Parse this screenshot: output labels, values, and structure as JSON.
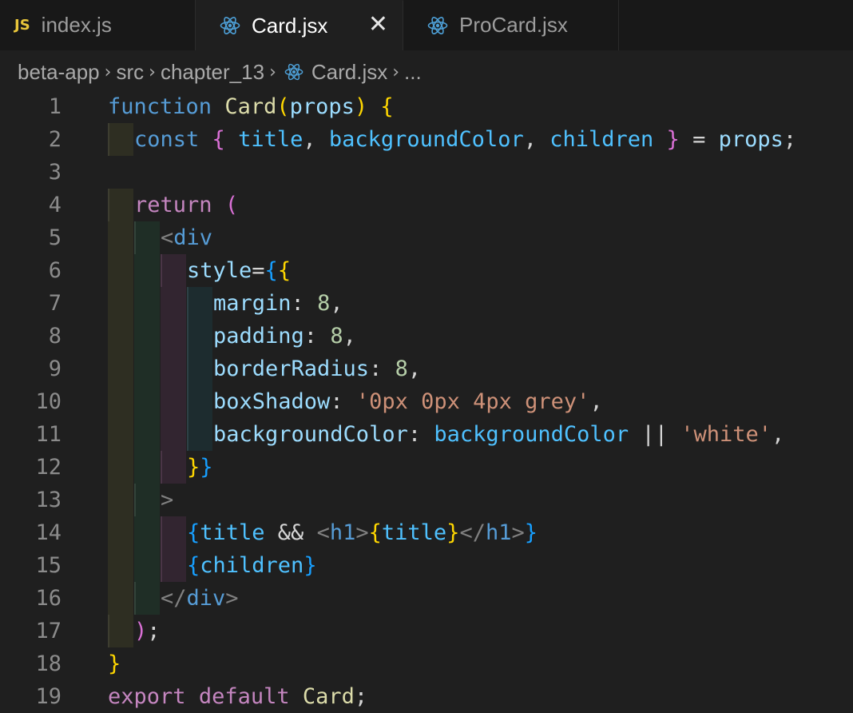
{
  "tabs": [
    {
      "label": "index.js",
      "icon": "js-icon",
      "badge": "JS",
      "active": false
    },
    {
      "label": "Card.jsx",
      "icon": "react-icon",
      "active": true,
      "close": "✕"
    },
    {
      "label": "ProCard.jsx",
      "icon": "react-icon",
      "active": false
    }
  ],
  "breadcrumb": {
    "items": [
      "beta-app",
      "src",
      "chapter_13",
      "Card.jsx"
    ],
    "ellipsis": "..."
  },
  "editor": {
    "line_numbers": [
      "1",
      "2",
      "3",
      "4",
      "5",
      "6",
      "7",
      "8",
      "9",
      "10",
      "11",
      "12",
      "13",
      "14",
      "15",
      "16",
      "17",
      "18",
      "19"
    ],
    "tokens": {
      "function": "function",
      "Card": "Card",
      "props": "props",
      "const": "const",
      "title": "title",
      "backgroundColor": "backgroundColor",
      "children": "children",
      "return": "return",
      "div": "div",
      "style": "style",
      "margin": "margin",
      "padding": "padding",
      "borderRadius": "borderRadius",
      "boxShadow": "boxShadow",
      "eight": "8",
      "shadow_value": "'0px 0px 4px grey'",
      "white": "'white'",
      "h1": "h1",
      "export": "export",
      "default": "default"
    }
  },
  "colors": {
    "editor_bg": "#1f1f1f",
    "tab_bg": "#181818",
    "keyword": "#569cd6",
    "control": "#c586c0",
    "function": "#dcdcaa",
    "variable": "#9cdcfe",
    "string": "#ce9178",
    "number": "#b5cea8",
    "react_icon": "#4d9fd6"
  }
}
